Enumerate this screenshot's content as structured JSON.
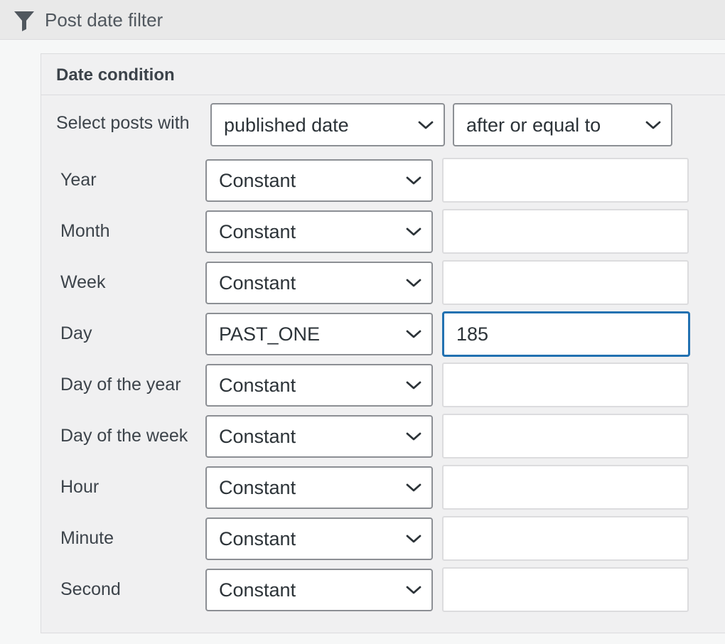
{
  "header": {
    "title": "Post date filter",
    "icon": "filter-icon"
  },
  "panel": {
    "title": "Date condition",
    "select_label": "Select posts with",
    "date_type": "published date",
    "comparison": "after or equal to"
  },
  "rows": [
    {
      "label": "Year",
      "mode": "Constant",
      "value": ""
    },
    {
      "label": "Month",
      "mode": "Constant",
      "value": ""
    },
    {
      "label": "Week",
      "mode": "Constant",
      "value": ""
    },
    {
      "label": "Day",
      "mode": "PAST_ONE",
      "value": "185"
    },
    {
      "label": "Day of the year",
      "mode": "Constant",
      "value": ""
    },
    {
      "label": "Day of the week",
      "mode": "Constant",
      "value": ""
    },
    {
      "label": "Hour",
      "mode": "Constant",
      "value": ""
    },
    {
      "label": "Minute",
      "mode": "Constant",
      "value": ""
    },
    {
      "label": "Second",
      "mode": "Constant",
      "value": ""
    }
  ],
  "colors": {
    "focus": "#2271b1",
    "border": "#8c8f94",
    "text": "#3c434a"
  }
}
